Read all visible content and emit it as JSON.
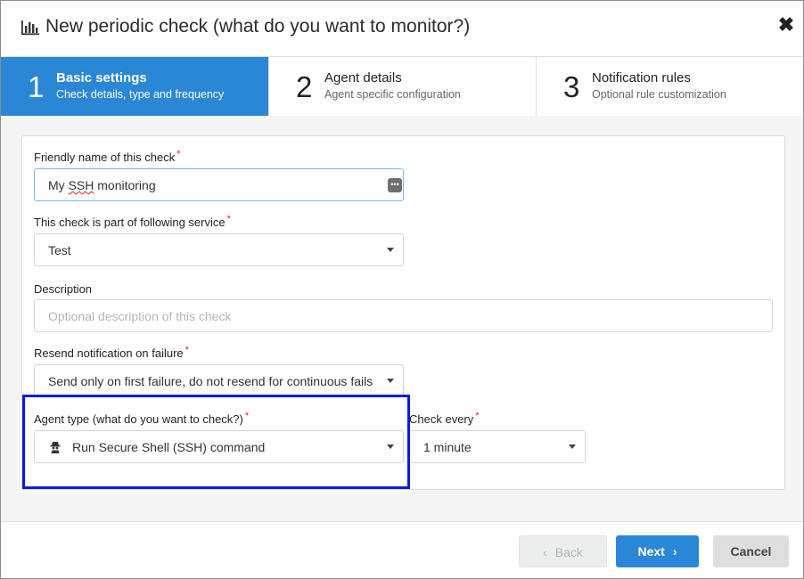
{
  "dialog": {
    "title": "New periodic check (what do you want to monitor?)",
    "title_icon": "bar-chart-icon",
    "close_symbol": "✖",
    "close_icon": "close-icon"
  },
  "steps": [
    {
      "number": "1",
      "name": "Basic settings",
      "description": "Check details, type and frequency",
      "active": true
    },
    {
      "number": "2",
      "name": "Agent details",
      "description": "Agent specific configuration",
      "active": false
    },
    {
      "number": "3",
      "name": "Notification rules",
      "description": "Optional rule customization",
      "active": false
    }
  ],
  "form": {
    "required_mark": "*",
    "friendly_name": {
      "label": "Friendly name of this check",
      "value_part1": "My ",
      "value_part2": "SSH",
      "value_part3": " monitoring",
      "suffix_icon": "more-dots-icon"
    },
    "service": {
      "label": "This check is part of following service",
      "value": "Test"
    },
    "description": {
      "label": "Description",
      "placeholder": "Optional description of this check",
      "value": ""
    },
    "resend": {
      "label": "Resend notification on failure",
      "value": "Send only on first failure, do not resend for continuous fails"
    },
    "agent_type": {
      "label": "Agent type (what do you want to check?)",
      "value": "Run Secure Shell (SSH) command",
      "icon": "spy-agent-icon"
    },
    "check_every": {
      "label": "Check every",
      "value": "1 minute"
    }
  },
  "footer": {
    "back_label": "Back",
    "next_label": "Next",
    "cancel_label": "Cancel",
    "back_chevron": "‹",
    "next_chevron": "›"
  },
  "colors": {
    "accent": "#2a87d6",
    "highlight_border": "#0a1ce0",
    "required": "#e02020"
  }
}
